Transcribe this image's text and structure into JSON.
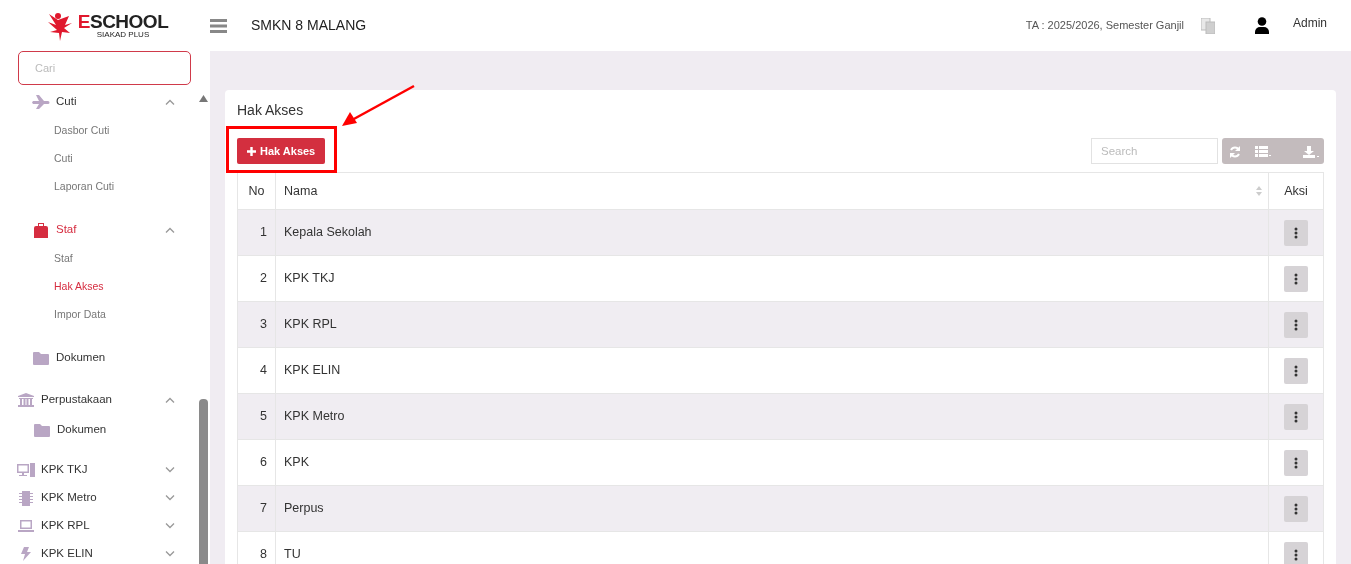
{
  "header": {
    "logo": {
      "name": "ESCHOOL",
      "tagline": "SIAKAD PLUS"
    },
    "school": "SMKN 8 MALANG",
    "academic_year": "TA : 2025/2026, Semester Ganjil",
    "user": "Admin"
  },
  "sidebar": {
    "search": {
      "placeholder": "Cari"
    },
    "nested_items": [
      {
        "kind": "menu",
        "label": "Cuti",
        "active": false,
        "expanded": true,
        "children": [
          {
            "label": "Dasbor Cuti",
            "selected": false
          },
          {
            "label": "Cuti",
            "selected": false
          },
          {
            "label": "Laporan Cuti",
            "selected": false
          }
        ]
      },
      {
        "kind": "menu",
        "label": "Staf",
        "active": true,
        "expanded": true,
        "children": [
          {
            "label": "Staf",
            "selected": false
          },
          {
            "label": "Hak Akses",
            "selected": true
          },
          {
            "label": "Impor Data",
            "selected": false
          }
        ]
      },
      {
        "kind": "link",
        "label": "Dokumen",
        "active": false
      }
    ],
    "items": [
      {
        "kind": "menu",
        "label": "Perpustakaan",
        "active": false,
        "expanded": true,
        "children": [
          {
            "kind": "link",
            "label": "Dokumen",
            "active": false
          }
        ]
      },
      {
        "kind": "menu",
        "label": "KPK TKJ",
        "active": false,
        "expanded": false
      },
      {
        "kind": "menu",
        "label": "KPK Metro",
        "active": false,
        "expanded": false
      },
      {
        "kind": "menu",
        "label": "KPK RPL",
        "active": false,
        "expanded": false
      },
      {
        "kind": "menu",
        "label": "KPK ELIN",
        "active": false,
        "expanded": false
      }
    ]
  },
  "card": {
    "title": "Hak Akses",
    "add_button": "Hak Akses",
    "search": {
      "placeholder": "Search"
    },
    "table": {
      "columns": [
        "No",
        "Nama",
        "Aksi"
      ],
      "rows": [
        {
          "no": "1",
          "nama": "Kepala Sekolah"
        },
        {
          "no": "2",
          "nama": "KPK TKJ"
        },
        {
          "no": "3",
          "nama": "KPK RPL"
        },
        {
          "no": "4",
          "nama": "KPK ELIN"
        },
        {
          "no": "5",
          "nama": "KPK Metro"
        },
        {
          "no": "6",
          "nama": "KPK"
        },
        {
          "no": "7",
          "nama": "Perpus"
        },
        {
          "no": "8",
          "nama": "TU"
        }
      ]
    }
  }
}
